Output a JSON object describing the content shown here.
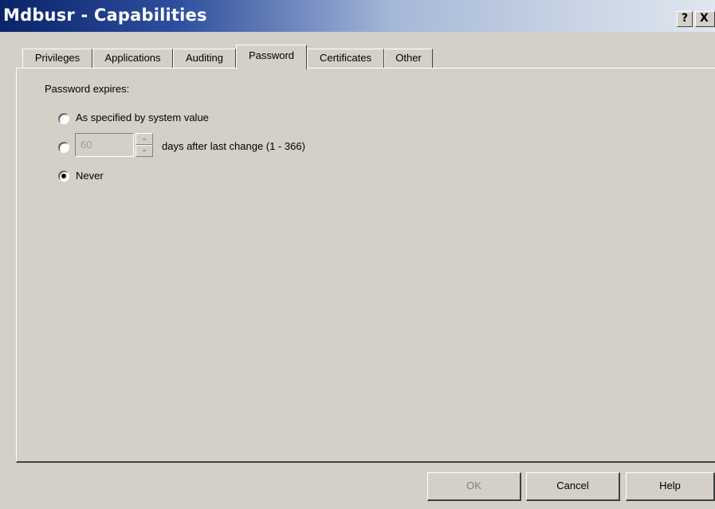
{
  "window": {
    "title": "Mdbusr - Capabilities",
    "help_button": "?",
    "close_button": "X"
  },
  "tabs": [
    {
      "label": "Privileges",
      "active": false
    },
    {
      "label": "Applications",
      "active": false
    },
    {
      "label": "Auditing",
      "active": false
    },
    {
      "label": "Password",
      "active": true
    },
    {
      "label": "Certificates",
      "active": false
    },
    {
      "label": "Other",
      "active": false
    }
  ],
  "password_panel": {
    "group_label": "Password expires:",
    "options": [
      {
        "label": "As specified by system value",
        "selected": false
      },
      {
        "label": "days after last change  (1 - 366)",
        "selected": false,
        "days_value": "60",
        "enabled": false
      },
      {
        "label": "Never",
        "selected": true
      }
    ]
  },
  "buttons": {
    "ok": "OK",
    "cancel": "Cancel",
    "help": "Help"
  }
}
